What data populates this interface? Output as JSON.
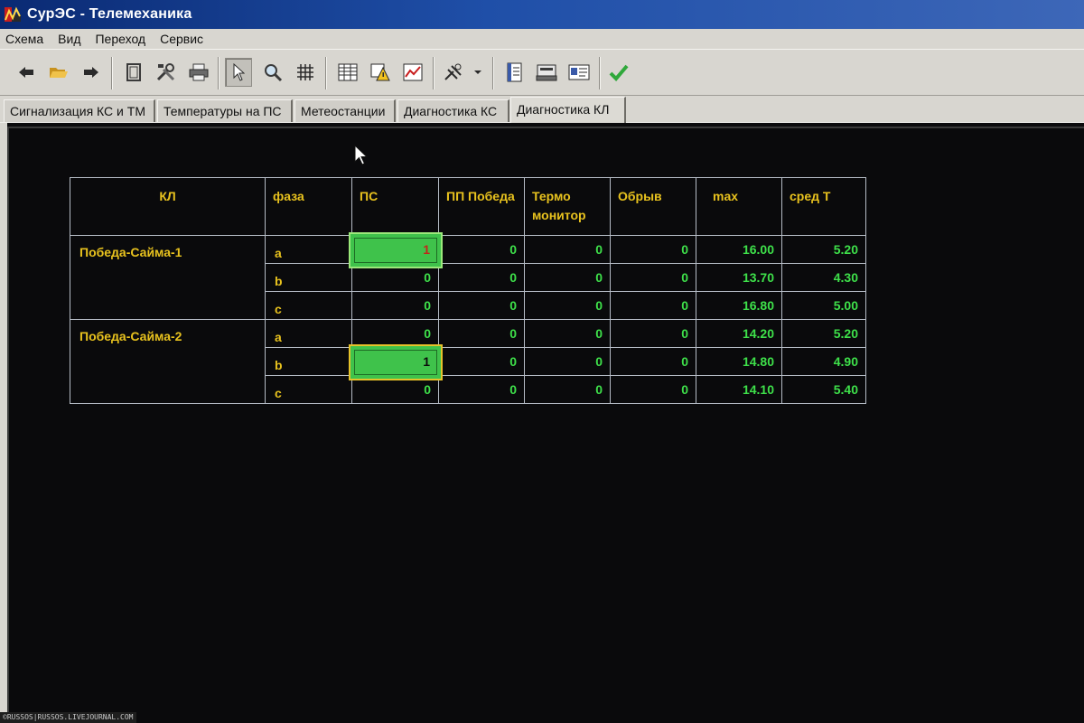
{
  "window": {
    "title": "СурЭС - Телемеханика"
  },
  "menu": {
    "items": [
      "Схема",
      "Вид",
      "Переход",
      "Сервис"
    ]
  },
  "toolbar": {
    "buttons": [
      {
        "icon": "arrow-left-icon",
        "color": "#2a2a2a"
      },
      {
        "icon": "folder-open-icon",
        "color": "#d8a628"
      },
      {
        "icon": "arrow-right-icon",
        "color": "#2a2a2a"
      },
      {
        "icon": "frame-icon",
        "color": "#2a2a2a"
      },
      {
        "icon": "tools-icon",
        "color": "#2a2a2a"
      },
      {
        "icon": "printer-icon",
        "color": "#2a2a2a"
      },
      {
        "icon": "pointer-icon",
        "color": "#2a2a2a"
      },
      {
        "icon": "magnifier-icon",
        "color": "#2a2a2a"
      },
      {
        "icon": "grid-icon",
        "color": "#2a2a2a"
      },
      {
        "icon": "table-icon",
        "color": "#2a2a2a"
      },
      {
        "icon": "warning-icon",
        "color": "#d8a628"
      },
      {
        "icon": "chart-icon",
        "color": "#2a2a2a"
      },
      {
        "icon": "connection-icon",
        "color": "#2a2a2a"
      },
      {
        "icon": "dropdown-arrow-icon",
        "color": "#2a2a2a"
      },
      {
        "icon": "notebook-icon",
        "color": "#2a2a2a"
      },
      {
        "icon": "device-icon",
        "color": "#2a2a2a"
      },
      {
        "icon": "card-icon",
        "color": "#2a2a2a"
      },
      {
        "icon": "check-icon",
        "color": "#2fa83a"
      }
    ]
  },
  "tabs": [
    {
      "label": "Сигнализация КС и ТМ",
      "active": false
    },
    {
      "label": "Температуры на ПС",
      "active": false
    },
    {
      "label": "Метеостанции",
      "active": false
    },
    {
      "label": "Диагностика КС",
      "active": false
    },
    {
      "label": "Диагностика КЛ",
      "active": true
    }
  ],
  "table": {
    "headers": {
      "kl": "КЛ",
      "phase": "фаза",
      "ps": "ПС",
      "pp": "ПП Победа",
      "thermo": "Термо монитор",
      "break": "Обрыв",
      "max": "max",
      "avg": "сред Т"
    },
    "groups": [
      {
        "name": "Победа-Сайма-1",
        "rows": [
          {
            "phase": "a",
            "ps": "1",
            "pp": "0",
            "thermo": "0",
            "break": "0",
            "max": "16.00",
            "avg": "5.20"
          },
          {
            "phase": "b",
            "ps": "0",
            "pp": "0",
            "thermo": "0",
            "break": "0",
            "max": "13.70",
            "avg": "4.30"
          },
          {
            "phase": "c",
            "ps": "0",
            "pp": "0",
            "thermo": "0",
            "break": "0",
            "max": "16.80",
            "avg": "5.00"
          }
        ]
      },
      {
        "name": "Победа-Сайма-2",
        "rows": [
          {
            "phase": "a",
            "ps": "0",
            "pp": "0",
            "thermo": "0",
            "break": "0",
            "max": "14.20",
            "avg": "5.20"
          },
          {
            "phase": "b",
            "ps": "1",
            "pp": "0",
            "thermo": "0",
            "break": "0",
            "max": "14.80",
            "avg": "4.90"
          },
          {
            "phase": "c",
            "ps": "0",
            "pp": "0",
            "thermo": "0",
            "break": "0",
            "max": "14.10",
            "avg": "5.40"
          }
        ]
      }
    ]
  },
  "watermark": "©RUSSOS|RUSSOS.LIVEJOURNAL.COM",
  "colors": {
    "label_yellow": "#e8c21e",
    "value_green": "#3ee04a",
    "alarm_box": "#3fc24b"
  }
}
